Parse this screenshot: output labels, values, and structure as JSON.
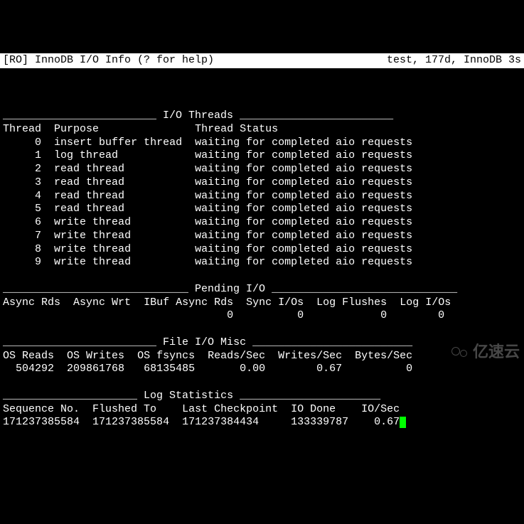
{
  "header": {
    "left": "[RO] InnoDB I/O Info (? for help)",
    "right": "test, 177d, InnoDB 3s"
  },
  "sections": {
    "io_threads": {
      "title": "I/O Threads",
      "col1": "Thread",
      "col2": "Purpose",
      "col3": "Thread Status",
      "rows": [
        {
          "id": "0",
          "purpose": "insert buffer thread",
          "status": "waiting for completed aio requests"
        },
        {
          "id": "1",
          "purpose": "log thread",
          "status": "waiting for completed aio requests"
        },
        {
          "id": "2",
          "purpose": "read thread",
          "status": "waiting for completed aio requests"
        },
        {
          "id": "3",
          "purpose": "read thread",
          "status": "waiting for completed aio requests"
        },
        {
          "id": "4",
          "purpose": "read thread",
          "status": "waiting for completed aio requests"
        },
        {
          "id": "5",
          "purpose": "read thread",
          "status": "waiting for completed aio requests"
        },
        {
          "id": "6",
          "purpose": "write thread",
          "status": "waiting for completed aio requests"
        },
        {
          "id": "7",
          "purpose": "write thread",
          "status": "waiting for completed aio requests"
        },
        {
          "id": "8",
          "purpose": "write thread",
          "status": "waiting for completed aio requests"
        },
        {
          "id": "9",
          "purpose": "write thread",
          "status": "waiting for completed aio requests"
        }
      ]
    },
    "pending_io": {
      "title": "Pending I/O",
      "headers": {
        "async_rds": "Async Rds",
        "async_wrt": "Async Wrt",
        "ibuf_async_rds": "IBuf Async Rds",
        "sync_ios": "Sync I/Os",
        "log_flushes": "Log Flushes",
        "log_ios": "Log I/Os"
      },
      "values": {
        "async_rds": "",
        "async_wrt": "",
        "ibuf_async_rds": "0",
        "sync_ios": "0",
        "log_flushes": "0",
        "log_ios": "0"
      }
    },
    "file_io_misc": {
      "title": "File I/O Misc",
      "headers": {
        "os_reads": "OS Reads",
        "os_writes": "OS Writes",
        "os_fsyncs": "OS fsyncs",
        "reads_sec": "Reads/Sec",
        "writes_sec": "Writes/Sec",
        "bytes_sec": "Bytes/Sec"
      },
      "values": {
        "os_reads": "504292",
        "os_writes": "209861768",
        "os_fsyncs": "68135485",
        "reads_sec": "0.00",
        "writes_sec": "0.67",
        "bytes_sec": "0"
      }
    },
    "log_stats": {
      "title": "Log Statistics",
      "headers": {
        "seq_no": "Sequence No.",
        "flushed_to": "Flushed To",
        "last_checkpoint": "Last Checkpoint",
        "io_done": "IO Done",
        "io_sec": "IO/Sec"
      },
      "values": {
        "seq_no": "171237385584",
        "flushed_to": "171237385584",
        "last_checkpoint": "171237384434",
        "io_done": "133339787",
        "io_sec": "0.67"
      }
    }
  },
  "watermark": "亿速云"
}
